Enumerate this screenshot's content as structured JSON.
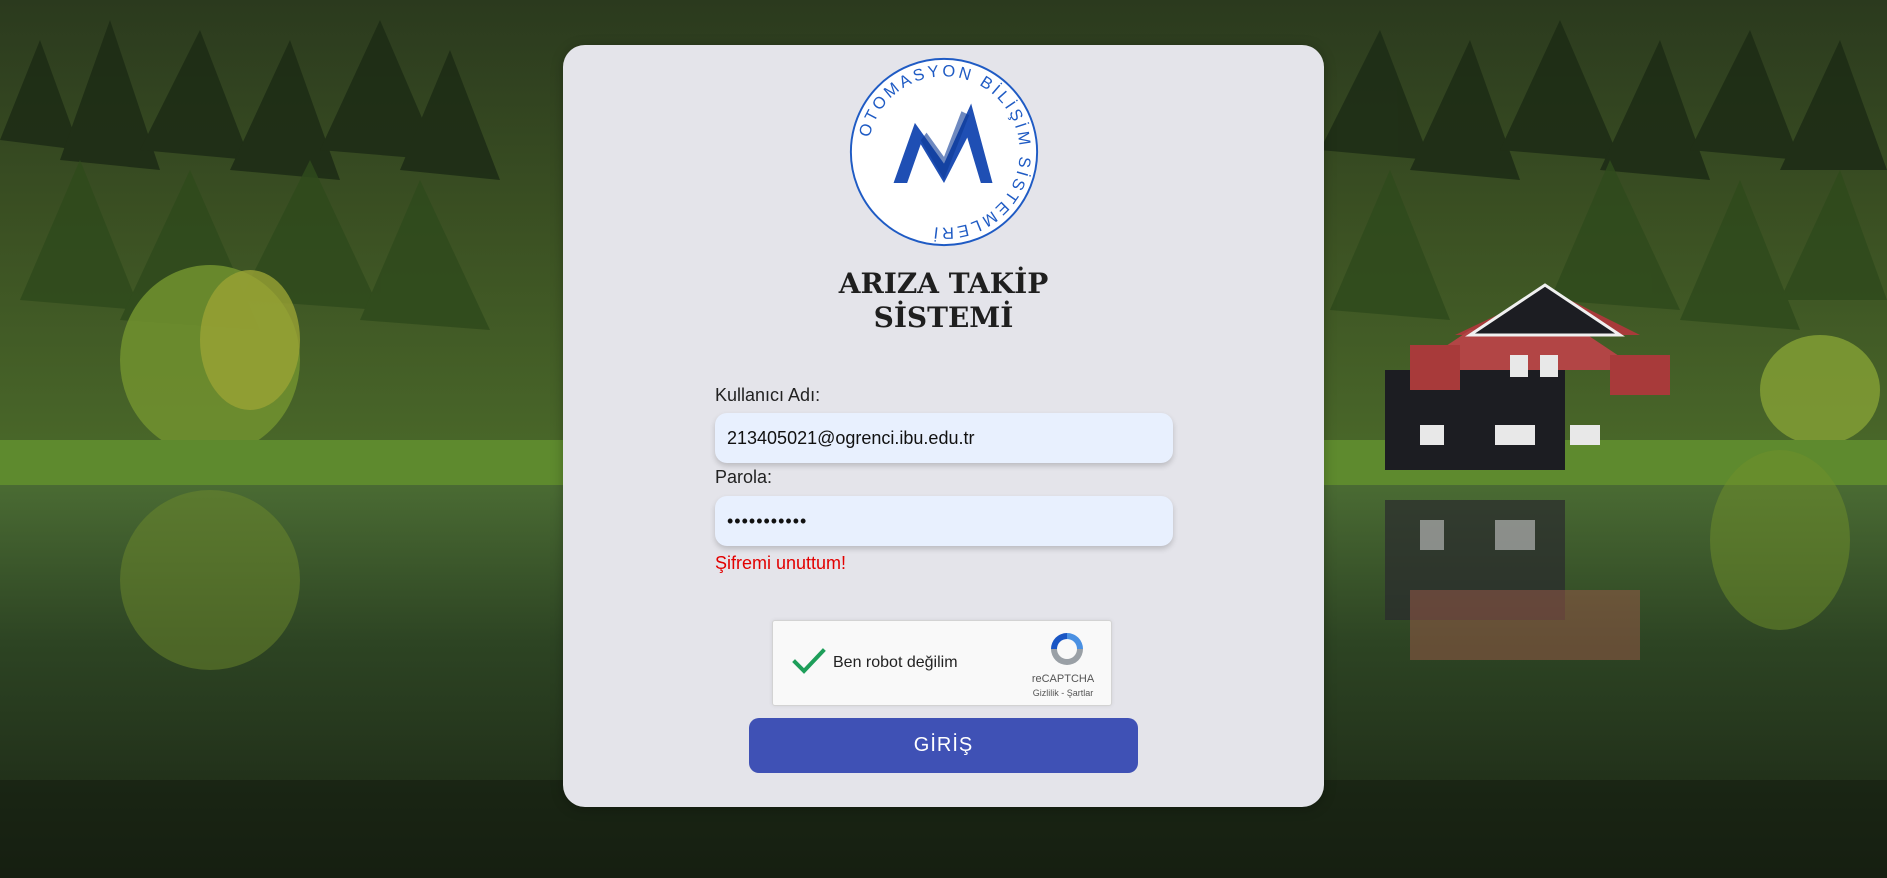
{
  "logo": {
    "ring_text": "OTOMASYON BİLİŞİM SİSTEMLERİ",
    "brand_color": "#1f5bc4"
  },
  "title": {
    "line1": "ARIZA TAKİP",
    "line2": "SİSTEMİ"
  },
  "form": {
    "username_label": "Kullanıcı Adı:",
    "username_value": "213405021@ogrenci.ibu.edu.tr",
    "password_label": "Parola:",
    "password_value": "•••••••••••",
    "forgot_link": "Şifremi unuttum!",
    "submit_label": "GİRİŞ"
  },
  "recaptcha": {
    "label": "Ben robot değilim",
    "checked": true,
    "brand": "reCAPTCHA",
    "links": "Gizlilik - Şartlar"
  },
  "colors": {
    "card_bg": "#e4e4ea",
    "input_bg": "#e8f0fe",
    "button_bg": "#3f51b5",
    "forgot_link": "#e20000"
  }
}
